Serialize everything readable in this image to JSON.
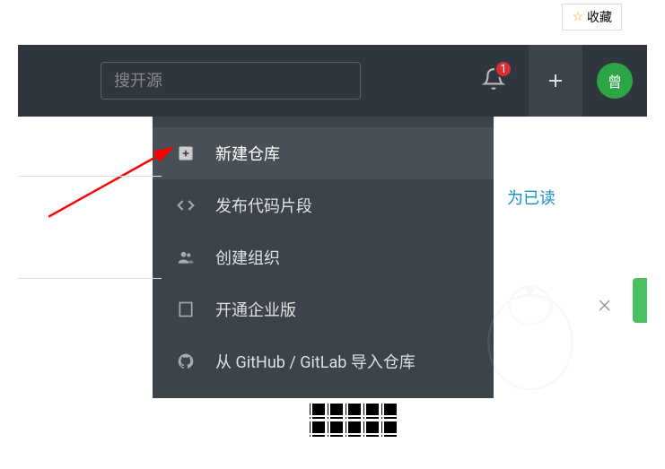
{
  "favorite": {
    "label": "收藏"
  },
  "search": {
    "placeholder": "搜开源"
  },
  "notification": {
    "count": "1"
  },
  "avatar": {
    "initial": "曾"
  },
  "dropdown": {
    "items": [
      {
        "label": "新建仓库"
      },
      {
        "label": "发布代码片段"
      },
      {
        "label": "创建组织"
      },
      {
        "label": "开通企业版"
      },
      {
        "label": "从 GitHub / GitLab 导入仓库"
      }
    ]
  },
  "link": {
    "text": "为已读"
  }
}
